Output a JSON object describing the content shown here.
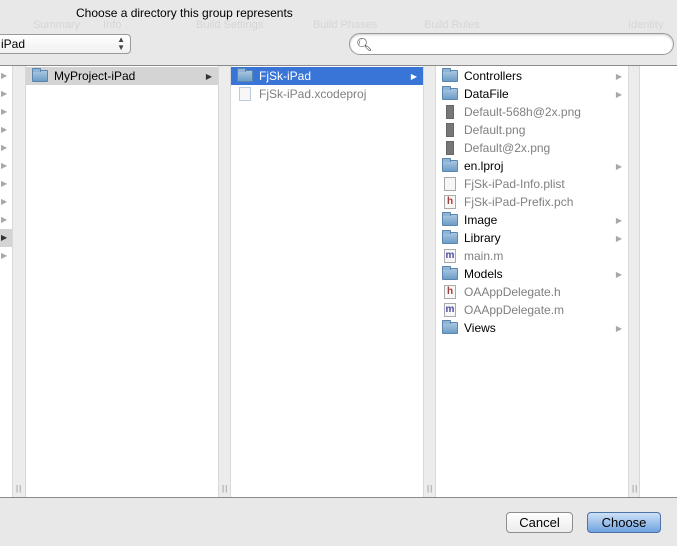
{
  "dialog": {
    "title": "Choose a directory this group represents"
  },
  "background_ghost": {
    "tabs": [
      "Summary",
      "Info",
      "Build Settings",
      "Build Phases",
      "Build Rules"
    ],
    "inspector": "Identity"
  },
  "location_popup": {
    "value": "iPad"
  },
  "search": {
    "value": "",
    "placeholder": ""
  },
  "columns": [
    {
      "items": [
        {
          "chev": "▶"
        },
        {
          "chev": "▶"
        },
        {
          "chev": "▶"
        },
        {
          "chev": "▶"
        },
        {
          "chev": "▶"
        },
        {
          "chev": "▶"
        },
        {
          "chev": "▶"
        },
        {
          "chev": "▶"
        },
        {
          "chev": "▶"
        },
        {
          "chev": "▶",
          "selected": true
        },
        {
          "chev": "▶"
        }
      ]
    },
    {
      "items": [
        {
          "label": "MyProject-iPad",
          "icon": "folder-icon",
          "folder": true,
          "selected": true
        }
      ]
    },
    {
      "items": [
        {
          "label": "FjSk-iPad",
          "icon": "folder-icon",
          "folder": true,
          "selected": true
        },
        {
          "label": "FjSk-iPad.xcodeproj",
          "icon": "xcodeproj-icon"
        }
      ]
    },
    {
      "items": [
        {
          "label": "Controllers",
          "icon": "folder-icon",
          "folder": true
        },
        {
          "label": "DataFile",
          "icon": "folder-icon",
          "folder": true
        },
        {
          "label": "Default-568h@2x.png",
          "icon": "png-file-icon"
        },
        {
          "label": "Default.png",
          "icon": "png-file-icon"
        },
        {
          "label": "Default@2x.png",
          "icon": "png-file-icon"
        },
        {
          "label": "en.lproj",
          "icon": "folder-icon",
          "folder": true
        },
        {
          "label": "FjSk-iPad-Info.plist",
          "icon": "plist-file-icon"
        },
        {
          "label": "FjSk-iPad-Prefix.pch",
          "icon": "header-file-icon",
          "glyph": "h"
        },
        {
          "label": "Image",
          "icon": "folder-icon",
          "folder": true
        },
        {
          "label": "Library",
          "icon": "folder-icon",
          "folder": true
        },
        {
          "label": "main.m",
          "icon": "objc-file-icon",
          "glyph": "m"
        },
        {
          "label": "Models",
          "icon": "folder-icon",
          "folder": true
        },
        {
          "label": "OAAppDelegate.h",
          "icon": "header-file-icon",
          "glyph": "h"
        },
        {
          "label": "OAAppDelegate.m",
          "icon": "objc-file-icon",
          "glyph": "m"
        },
        {
          "label": "Views",
          "icon": "folder-icon",
          "folder": true
        }
      ]
    }
  ],
  "chevron": "▶",
  "grip": "||",
  "buttons": {
    "cancel": "Cancel",
    "choose": "Choose"
  },
  "colors": {
    "selection": "#3875d7",
    "default_button": "#6fa2e0"
  }
}
